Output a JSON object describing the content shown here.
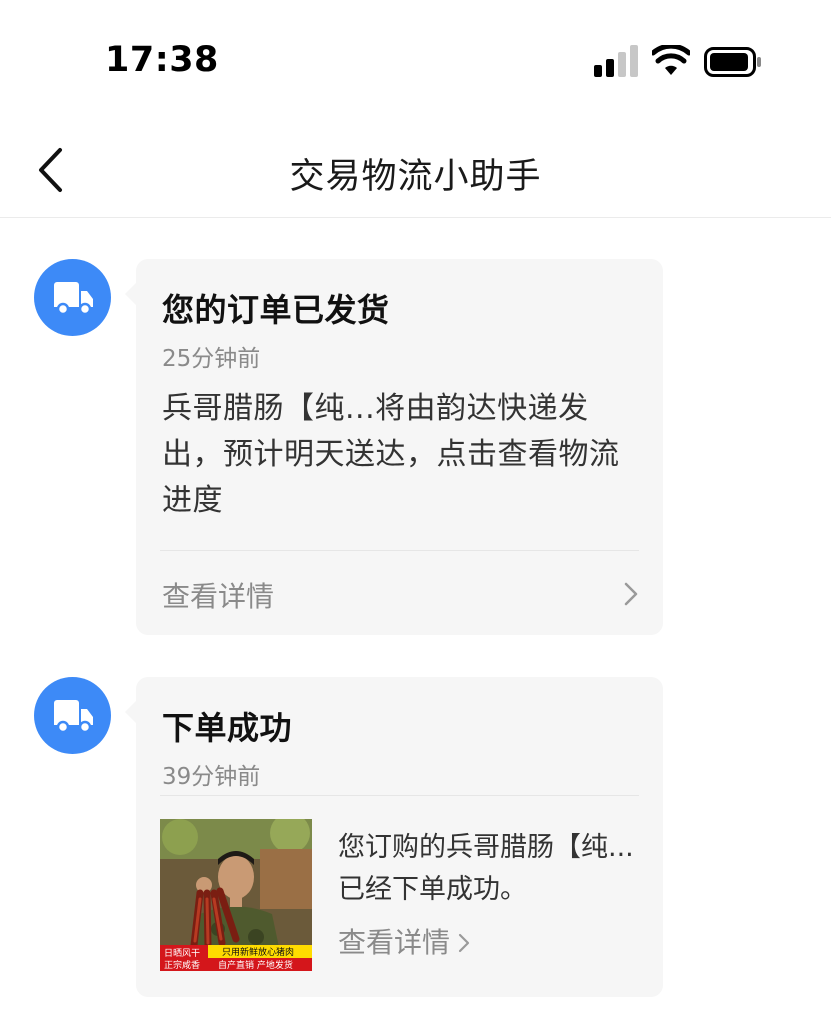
{
  "status_bar": {
    "time": "17:38"
  },
  "nav": {
    "title": "交易物流小助手"
  },
  "messages": [
    {
      "title": "您的订单已发货",
      "time": "25分钟前",
      "body": "兵哥腊肠【纯...将由韵达快递发出，预计明天送达，点击查看物流进度",
      "detail_label": "查看详情"
    },
    {
      "title": "下单成功",
      "time": "39分钟前",
      "product_text": "您订购的兵哥腊肠【纯...已经下单成功。",
      "detail_label": "查看详情",
      "thumb_banner": {
        "left_top": "日晒风干",
        "left_bottom": "正宗咸香",
        "right_top": "只用新鲜放心猪肉",
        "right_bottom": "自产直销  产地发货"
      }
    }
  ],
  "colors": {
    "avatar": "#3d8af7",
    "card": "#f6f6f6",
    "secondary_text": "#8a8a8a"
  }
}
